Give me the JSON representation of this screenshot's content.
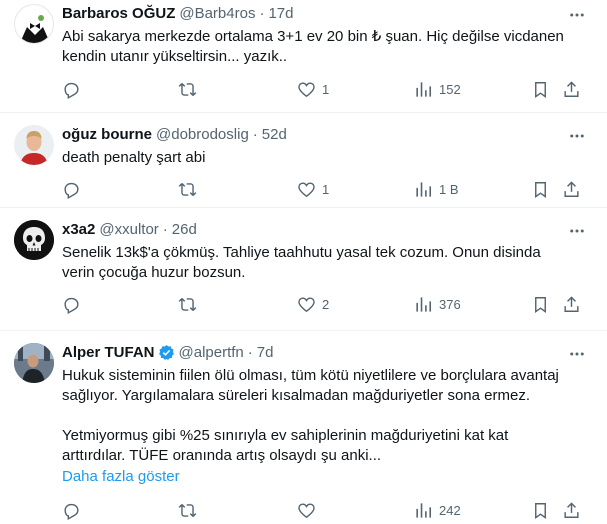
{
  "colors": {
    "text": "#0f1419",
    "secondary": "#536471",
    "link": "#1d9bf0",
    "divider": "#eff3f4"
  },
  "tweets": [
    {
      "name": "Barbaros OĞUZ",
      "handle": "@Barb4ros",
      "separator": "·",
      "time": "17d",
      "verified": false,
      "lines": [
        "Abi sakarya merkezde ortalama 3+1 ev 20 bin ₺ şuan. Hiç değilse vicdanen",
        "kendin utanır yükseltirsin... yazık.."
      ],
      "replies": "",
      "retweets": "",
      "likes": "1",
      "views": "152"
    },
    {
      "name": "oğuz bourne",
      "handle": "@dobrodoslig",
      "separator": "·",
      "time": "52d",
      "verified": false,
      "lines": [
        "death penalty şart abi"
      ],
      "replies": "",
      "retweets": "",
      "likes": "1",
      "views": "1 B"
    },
    {
      "name": "x3a2",
      "handle": "@xxultor",
      "separator": "·",
      "time": "26d",
      "verified": false,
      "lines": [
        "Senelik 13k$'a çökmüş. Tahliye taahhutu yasal tek cozum. Onun disinda",
        "verin çocuğa huzur bozsun."
      ],
      "replies": "",
      "retweets": "",
      "likes": "2",
      "views": "376"
    },
    {
      "name": "Alper TUFAN",
      "handle": "@alpertfn",
      "separator": "·",
      "time": "7d",
      "verified": true,
      "lines": [
        "Hukuk sisteminin fiilen ölü olması, tüm kötü niyetlilere ve borçlulara avantaj",
        "sağlıyor. Yargılamalara süreleri kısalmadan mağduriyetler sona ermez."
      ],
      "lines2": [
        "Yetmiyormuş gibi %25 sınırıyla ev sahiplerinin mağduriyetini kat kat",
        "arttırdılar. TÜFE oranında artış olsaydı şu anki..."
      ],
      "show_more": "Daha fazla göster",
      "replies": "",
      "retweets": "",
      "likes": "",
      "views": "242"
    }
  ]
}
